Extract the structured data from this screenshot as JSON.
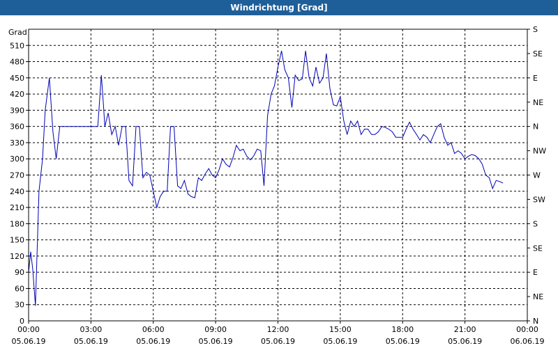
{
  "window": {
    "title": "Windrichtung [Grad]"
  },
  "chart_data": {
    "type": "line",
    "title": "Windrichtung [Grad]",
    "ylabel": "Grad",
    "xlabel": "",
    "ylim": [
      0,
      540
    ],
    "xlim_hours": [
      0,
      24
    ],
    "y_ticks": [
      30,
      60,
      90,
      120,
      150,
      180,
      210,
      240,
      270,
      300,
      330,
      360,
      390,
      420,
      450,
      480,
      510
    ],
    "x_ticks": [
      {
        "time": "00:00",
        "date": "05.06.19"
      },
      {
        "time": "03:00",
        "date": "05.06.19"
      },
      {
        "time": "06:00",
        "date": "05.06.19"
      },
      {
        "time": "09:00",
        "date": "05.06.19"
      },
      {
        "time": "12:00",
        "date": "05.06.19"
      },
      {
        "time": "15:00",
        "date": "05.06.19"
      },
      {
        "time": "18:00",
        "date": "05.06.19"
      },
      {
        "time": "21:00",
        "date": "05.06.19"
      },
      {
        "time": "00:00",
        "date": "06.06.19"
      }
    ],
    "right_axis_labels": [
      {
        "label": "S",
        "value": 540
      },
      {
        "label": "SE",
        "value": 495
      },
      {
        "label": "E",
        "value": 450
      },
      {
        "label": "NE",
        "value": 405
      },
      {
        "label": "N",
        "value": 360
      },
      {
        "label": "NW",
        "value": 315
      },
      {
        "label": "W",
        "value": 270
      },
      {
        "label": "SW",
        "value": 225
      },
      {
        "label": "S",
        "value": 180
      },
      {
        "label": "SE",
        "value": 135
      },
      {
        "label": "E",
        "value": 90
      },
      {
        "label": "NE",
        "value": 45
      },
      {
        "label": "N",
        "value": 0
      }
    ],
    "grid": true,
    "series": [
      {
        "color": "#0000b4",
        "x_hours": [
          0.0,
          0.1,
          0.2,
          0.33,
          0.5,
          0.67,
          0.8,
          0.9,
          1.0,
          1.17,
          1.33,
          1.5,
          2.0,
          2.5,
          3.0,
          3.17,
          3.33,
          3.5,
          3.6,
          3.67,
          3.83,
          4.0,
          4.17,
          4.33,
          4.5,
          4.67,
          4.83,
          5.0,
          5.17,
          5.33,
          5.5,
          5.67,
          5.83,
          6.0,
          6.17,
          6.33,
          6.5,
          6.67,
          6.83,
          7.0,
          7.17,
          7.33,
          7.5,
          7.67,
          7.83,
          8.0,
          8.17,
          8.33,
          8.5,
          8.67,
          8.83,
          9.0,
          9.17,
          9.33,
          9.5,
          9.67,
          9.83,
          10.0,
          10.17,
          10.33,
          10.5,
          10.67,
          10.83,
          11.0,
          11.17,
          11.33,
          11.5,
          11.67,
          11.83,
          12.0,
          12.17,
          12.33,
          12.5,
          12.67,
          12.83,
          13.0,
          13.17,
          13.33,
          13.5,
          13.67,
          13.83,
          14.0,
          14.17,
          14.33,
          14.5,
          14.67,
          14.83,
          15.0,
          15.17,
          15.33,
          15.5,
          15.67,
          15.83,
          16.0,
          16.17,
          16.33,
          16.5,
          16.67,
          16.83,
          17.0,
          17.17,
          17.33,
          17.5,
          17.67,
          17.83,
          18.0,
          18.17,
          18.33,
          18.5,
          18.67,
          18.83,
          19.0,
          19.17,
          19.33,
          19.5,
          19.67,
          19.83,
          20.0,
          20.17,
          20.33,
          20.5,
          20.67,
          20.83,
          21.0,
          21.17,
          21.33,
          21.5,
          21.67,
          21.83,
          22.0,
          22.17,
          22.33,
          22.5,
          22.67,
          22.83,
          23.0,
          23.17,
          23.33,
          23.5,
          23.67,
          23.83
        ],
        "values": [
          90,
          128,
          95,
          28,
          240,
          300,
          390,
          420,
          450,
          350,
          300,
          360,
          360,
          360,
          360,
          360,
          360,
          455,
          400,
          360,
          385,
          345,
          360,
          325,
          360,
          360,
          260,
          250,
          360,
          360,
          265,
          275,
          270,
          240,
          210,
          230,
          240,
          240,
          360,
          360,
          250,
          245,
          260,
          235,
          230,
          228,
          265,
          260,
          272,
          282,
          270,
          265,
          280,
          300,
          290,
          285,
          302,
          325,
          315,
          318,
          305,
          298,
          305,
          318,
          315,
          250,
          380,
          420,
          435,
          470,
          500,
          465,
          450,
          395,
          455,
          445,
          448,
          500,
          450,
          435,
          470,
          440,
          450,
          495,
          430,
          400,
          398,
          415,
          370,
          345,
          370,
          360,
          370,
          345,
          355,
          355,
          345,
          345,
          350,
          360,
          358,
          355,
          350,
          340,
          340,
          340,
          355,
          368,
          355,
          345,
          335,
          345,
          340,
          330,
          345,
          360,
          365,
          340,
          325,
          330,
          310,
          315,
          310,
          300,
          305,
          308,
          306,
          300,
          290,
          270,
          265,
          245,
          260,
          258,
          255
        ]
      }
    ]
  }
}
